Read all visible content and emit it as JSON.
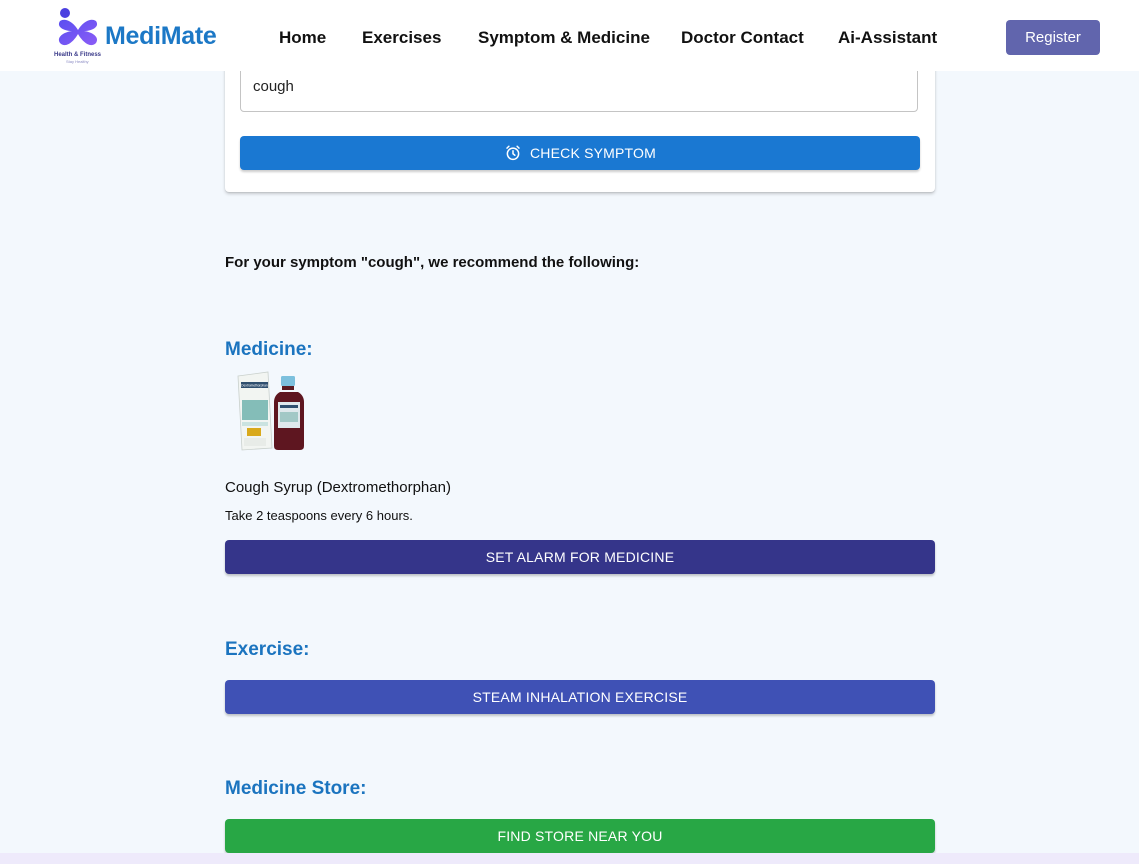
{
  "nav": {
    "brand": "MediMate",
    "logo_tagline": "Health & Fitness",
    "logo_subtagline": "Stay Healthy",
    "links": [
      "Home",
      "Exercises",
      "Symptom & Medicine",
      "Doctor Contact",
      "Ai-Assistant"
    ],
    "register_label": "Register"
  },
  "search": {
    "value": "cough",
    "button_label": "CHECK SYMPTOM"
  },
  "results": {
    "intro": "For your symptom \"cough\", we recommend the following:",
    "medicine": {
      "heading": "Medicine:",
      "name": "Cough Syrup (Dextromethorphan)",
      "dosage": "Take 2 teaspoons every 6 hours.",
      "alarm_label": "SET ALARM FOR MEDICINE",
      "box_label": "Dextromethorphan"
    },
    "exercise": {
      "heading": "Exercise:",
      "button_label": "STEAM INHALATION EXERCISE"
    },
    "store": {
      "heading": "Medicine Store:",
      "button_label": "FIND STORE NEAR YOU"
    }
  },
  "colors": {
    "brand": "#1c78c6",
    "check_button": "#1a78d2",
    "alarm_button": "#35358a",
    "exercise_button": "#3f51b5",
    "store_button": "#28a745",
    "register_button": "#6165ad",
    "heading": "#1b74bf"
  }
}
